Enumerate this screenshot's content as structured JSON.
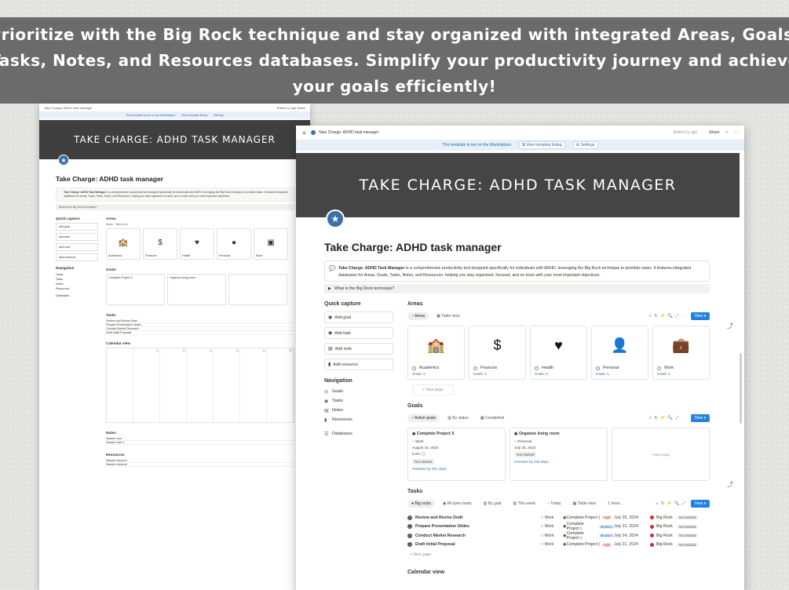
{
  "banner": {
    "line1": "Prioritize with the Big Rock technique and stay organized with integrated Areas, Goals,",
    "line2": "Tasks, Notes, and Resources databases. Simplify your productivity journey and achieve",
    "line3": "your goals efficiently!"
  },
  "app": {
    "tab_title": "Take Charge: ADHD task manager",
    "edited": "Edited 1y ago",
    "share": "Share",
    "template_notice": "This template is live on the Marketplace",
    "view_listing": "View template listing",
    "settings": "Settings"
  },
  "page": {
    "cover_title": "TAKE CHARGE: ADHD TASK MANAGER",
    "title": "Take Charge: ADHD task manager",
    "callout_bold": "Take Charge: ADHD Task Manager",
    "callout_text": " is a comprehensive productivity tool designed specifically for individuals with ADHD, leveraging the Big Rock technique to prioritize tasks. It features integrated databases for Areas, Goals, Tasks, Notes, and Resources, helping you stay organized, focused, and on track with your most important objectives.",
    "toggle_label": "What is the Big Rock technique?"
  },
  "common": {
    "new": "New",
    "new_page": "New page"
  },
  "quick_capture": {
    "heading": "Quick capture",
    "buttons": [
      "Add goal",
      "Add task",
      "Add note",
      "Add resource"
    ]
  },
  "navigation": {
    "heading": "Navigation",
    "items": [
      "Goals",
      "Tasks",
      "Notes",
      "Resources"
    ],
    "databases": "Databases"
  },
  "areas": {
    "heading": "Areas",
    "views": [
      "Areas",
      "Table view"
    ],
    "cards": [
      {
        "name": "Academics",
        "goals": "Goals: 0",
        "icon": "school-icon"
      },
      {
        "name": "Finances",
        "goals": "Goals: 0",
        "icon": "dollar-icon"
      },
      {
        "name": "Health",
        "goals": "Goals: 0",
        "icon": "heart-pulse-icon"
      },
      {
        "name": "Personal",
        "goals": "Goals: 1",
        "icon": "person-icon"
      },
      {
        "name": "Work",
        "goals": "Goals: 1",
        "icon": "briefcase-icon"
      }
    ]
  },
  "goals": {
    "heading": "Goals",
    "views": [
      "Active goals",
      "By status",
      "Completed"
    ],
    "cards": [
      {
        "title": "Complete Project X",
        "area": "Work",
        "date": "August 10, 2024",
        "progress": "0.0%",
        "status": "Not started",
        "overdue": "Overdue by 401 days"
      },
      {
        "title": "Organize living room",
        "area": "Personal",
        "date": "July 25, 2024",
        "status": "Not started",
        "overdue": "Overdue by 426 days"
      }
    ]
  },
  "tasks": {
    "heading": "Tasks",
    "views": [
      "Big rocks",
      "All open tasks",
      "By goal",
      "This week",
      "Today",
      "Table view",
      "1 more..."
    ],
    "rows": [
      {
        "name": "Review and Revise Draft",
        "area": "Work",
        "goal": "Complete Project )",
        "priority": "High",
        "date": "July 25, 2024",
        "tag": "Big Rock",
        "status": "Not started"
      },
      {
        "name": "Prepare Presentation Slides",
        "area": "Work",
        "goal": "Complete Project )",
        "priority": "Medium",
        "date": "July 22, 2024",
        "tag": "Big Rock",
        "status": "Not started"
      },
      {
        "name": "Conduct Market Research",
        "area": "Work",
        "goal": "Complete Project )",
        "priority": "Medium",
        "date": "July 24, 2024",
        "tag": "Big Rock",
        "status": "Not started"
      },
      {
        "name": "Draft Initial Proposal",
        "area": "Work",
        "goal": "Complete Project )",
        "priority": "High",
        "date": "July 21, 2024",
        "tag": "Big Rock",
        "status": "Not started"
      }
    ]
  },
  "calendar": {
    "heading": "Calendar view"
  },
  "notes": {
    "heading": "Notes",
    "rows": [
      "Sample note",
      "Sample note II"
    ]
  },
  "resources": {
    "heading": "Resources",
    "rows": [
      "Sample resource",
      "Sample resource"
    ]
  },
  "colors": {
    "banner": "#6b6b6b",
    "cover": "#454545",
    "accent": "#2383e2",
    "logo": "#3d6fa8",
    "big_rock": "#d4283a"
  }
}
